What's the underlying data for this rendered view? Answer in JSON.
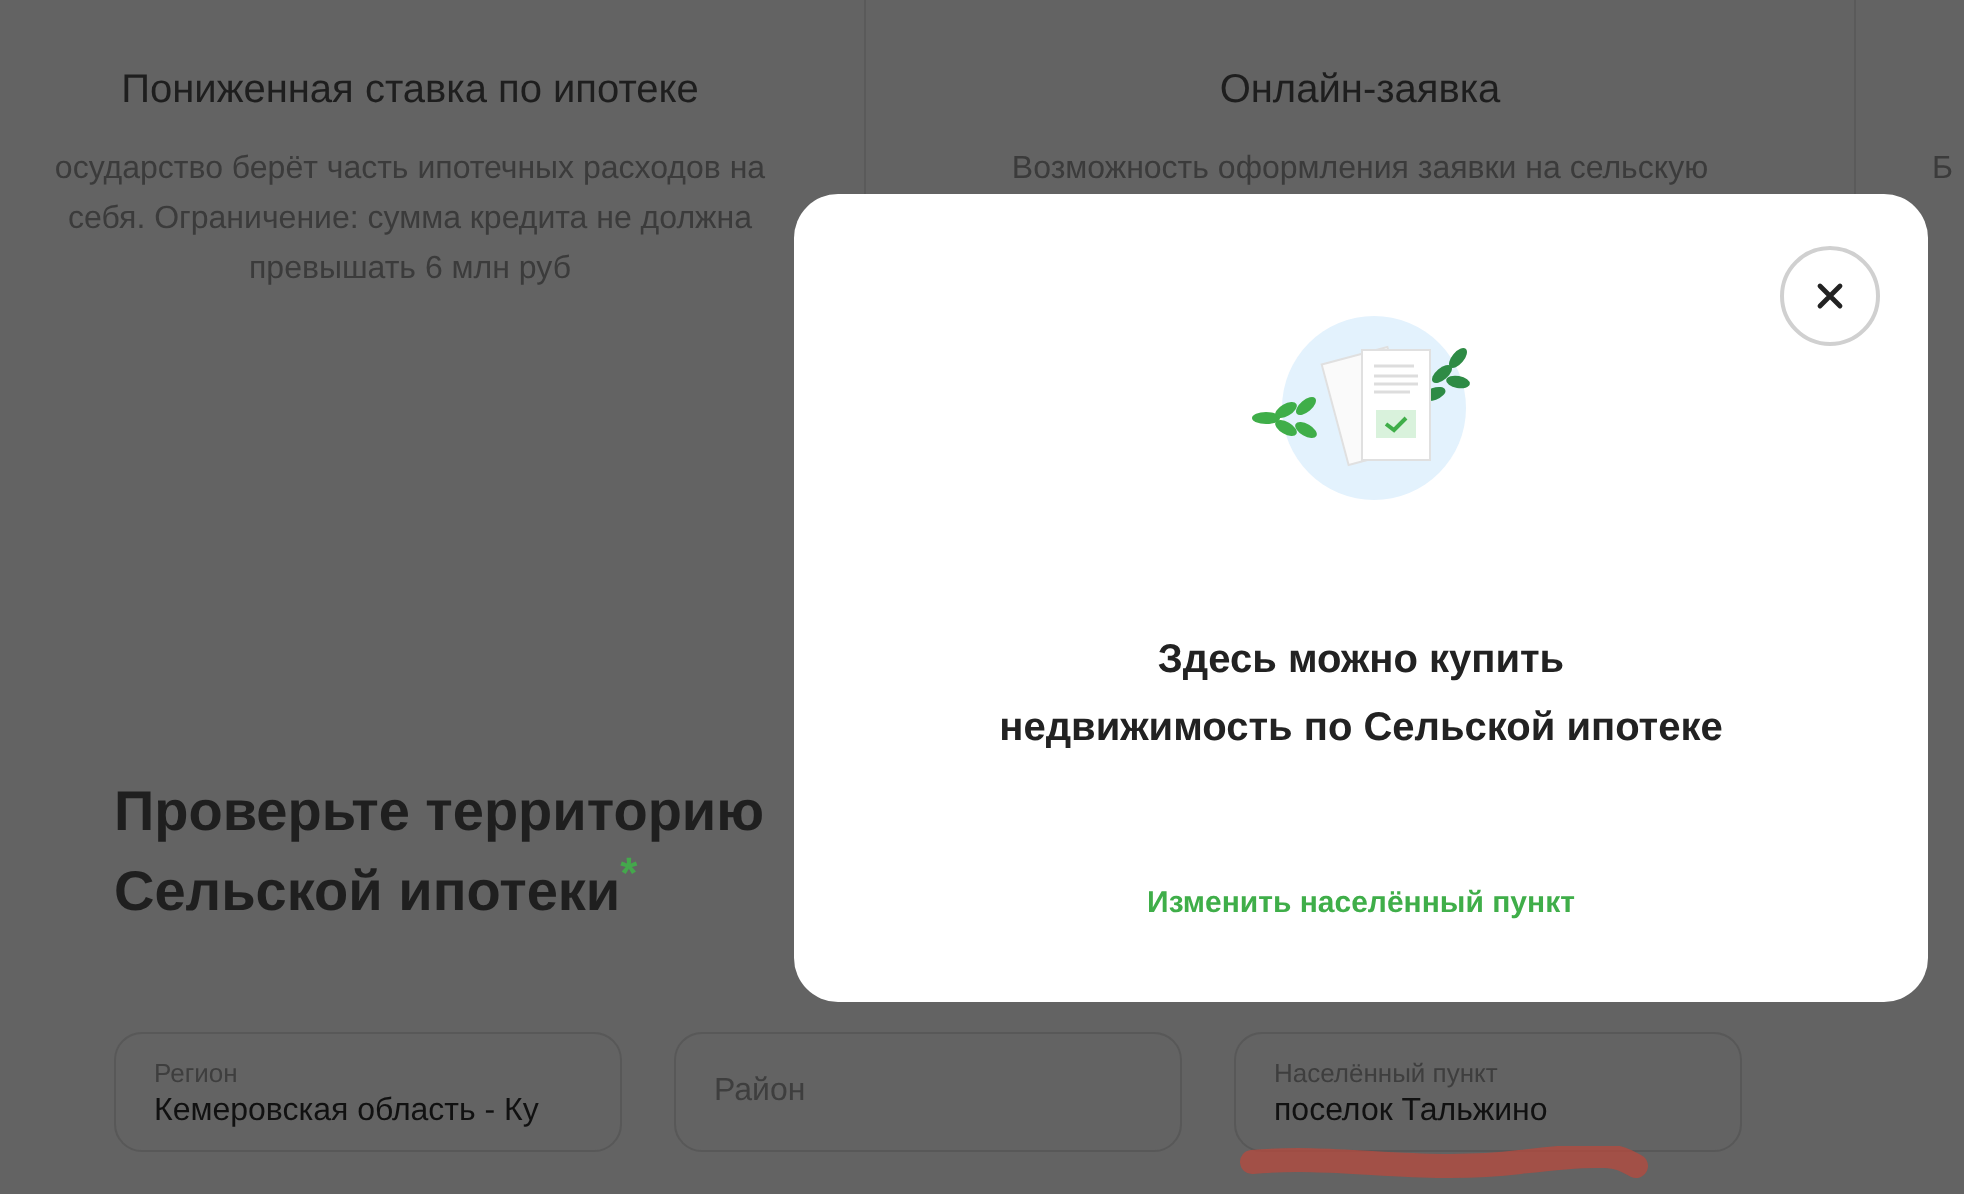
{
  "features": [
    {
      "title": "Пониженная ставка по ипотеке",
      "lines": [
        "осударство берёт часть ипотечных расходов на",
        "себя. Ограничение: сумма кредита не должна",
        "превышать 6 млн руб"
      ]
    },
    {
      "title": "Онлайн-заявка",
      "lines": [
        "Возможность оформления заявки на сельскую"
      ]
    },
    {
      "lines": [
        "Б"
      ]
    }
  ],
  "check": {
    "title_lines": [
      "Проверьте территорию",
      "Сельской ипотеки"
    ],
    "required_mark": "*",
    "fields": [
      {
        "label": "Регион",
        "value": "Кемеровская область - Ку"
      },
      {
        "placeholder": "Район"
      },
      {
        "label": "Населённый пункт",
        "value": "поселок Тальжино"
      }
    ]
  },
  "modal": {
    "message_lines": [
      "Здесь можно купить",
      "недвижимость по Сельской ипотеке"
    ],
    "link": "Изменить населённый пункт"
  }
}
